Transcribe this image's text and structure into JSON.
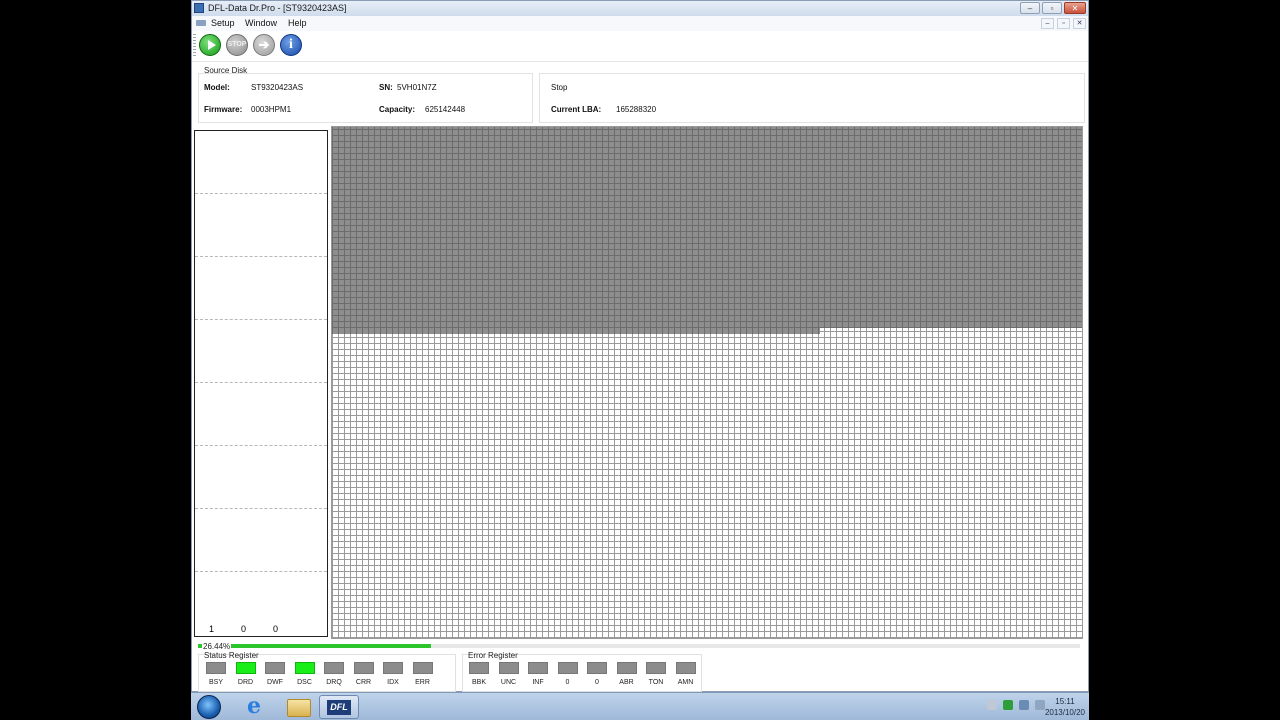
{
  "window": {
    "title": "DFL-Data Dr.Pro - [ST9320423AS]",
    "controls": [
      "–",
      "▫",
      "✕"
    ]
  },
  "menu": {
    "items": [
      "Setup",
      "Window",
      "Help"
    ]
  },
  "toolbar": {
    "stop_label": "STOP",
    "info_label": "i",
    "next_label": "➔"
  },
  "source_disk": {
    "title": "Source Disk",
    "model_label": "Model:",
    "model_value": "ST9320423AS",
    "firmware_label": "Firmware:",
    "firmware_value": "0003HPM1",
    "sn_label": "SN:",
    "sn_value": "5VH01N7Z",
    "capacity_label": "Capacity:",
    "capacity_value": "625142448"
  },
  "status_panel": {
    "state": "Stop",
    "lba_label": "Current LBA:",
    "lba_value": "165288320"
  },
  "counters": [
    "1",
    "0",
    "0"
  ],
  "progress": {
    "percent_text": "26.44%",
    "fraction": 0.2644
  },
  "status_register": {
    "title": "Status Register",
    "leds": [
      {
        "label": "BSY",
        "on": false
      },
      {
        "label": "DRD",
        "on": true
      },
      {
        "label": "DWF",
        "on": false
      },
      {
        "label": "DSC",
        "on": true
      },
      {
        "label": "DRQ",
        "on": false
      },
      {
        "label": "CRR",
        "on": false
      },
      {
        "label": "IDX",
        "on": false
      },
      {
        "label": "ERR",
        "on": false
      }
    ]
  },
  "error_register": {
    "title": "Error Register",
    "leds": [
      {
        "label": "BBK",
        "on": false
      },
      {
        "label": "UNC",
        "on": false
      },
      {
        "label": "INF",
        "on": false
      },
      {
        "label": "0",
        "on": false
      },
      {
        "label": "0",
        "on": false
      },
      {
        "label": "ABR",
        "on": false
      },
      {
        "label": "TON",
        "on": false
      },
      {
        "label": "AMN",
        "on": false
      }
    ]
  },
  "taskbar": {
    "dfl_label": "DFL",
    "time": "15:11",
    "date": "2013/10/20"
  },
  "colors": {
    "led_on": "#19ee19",
    "led_off": "#8c8c8c",
    "progress": "#2cc52c"
  }
}
